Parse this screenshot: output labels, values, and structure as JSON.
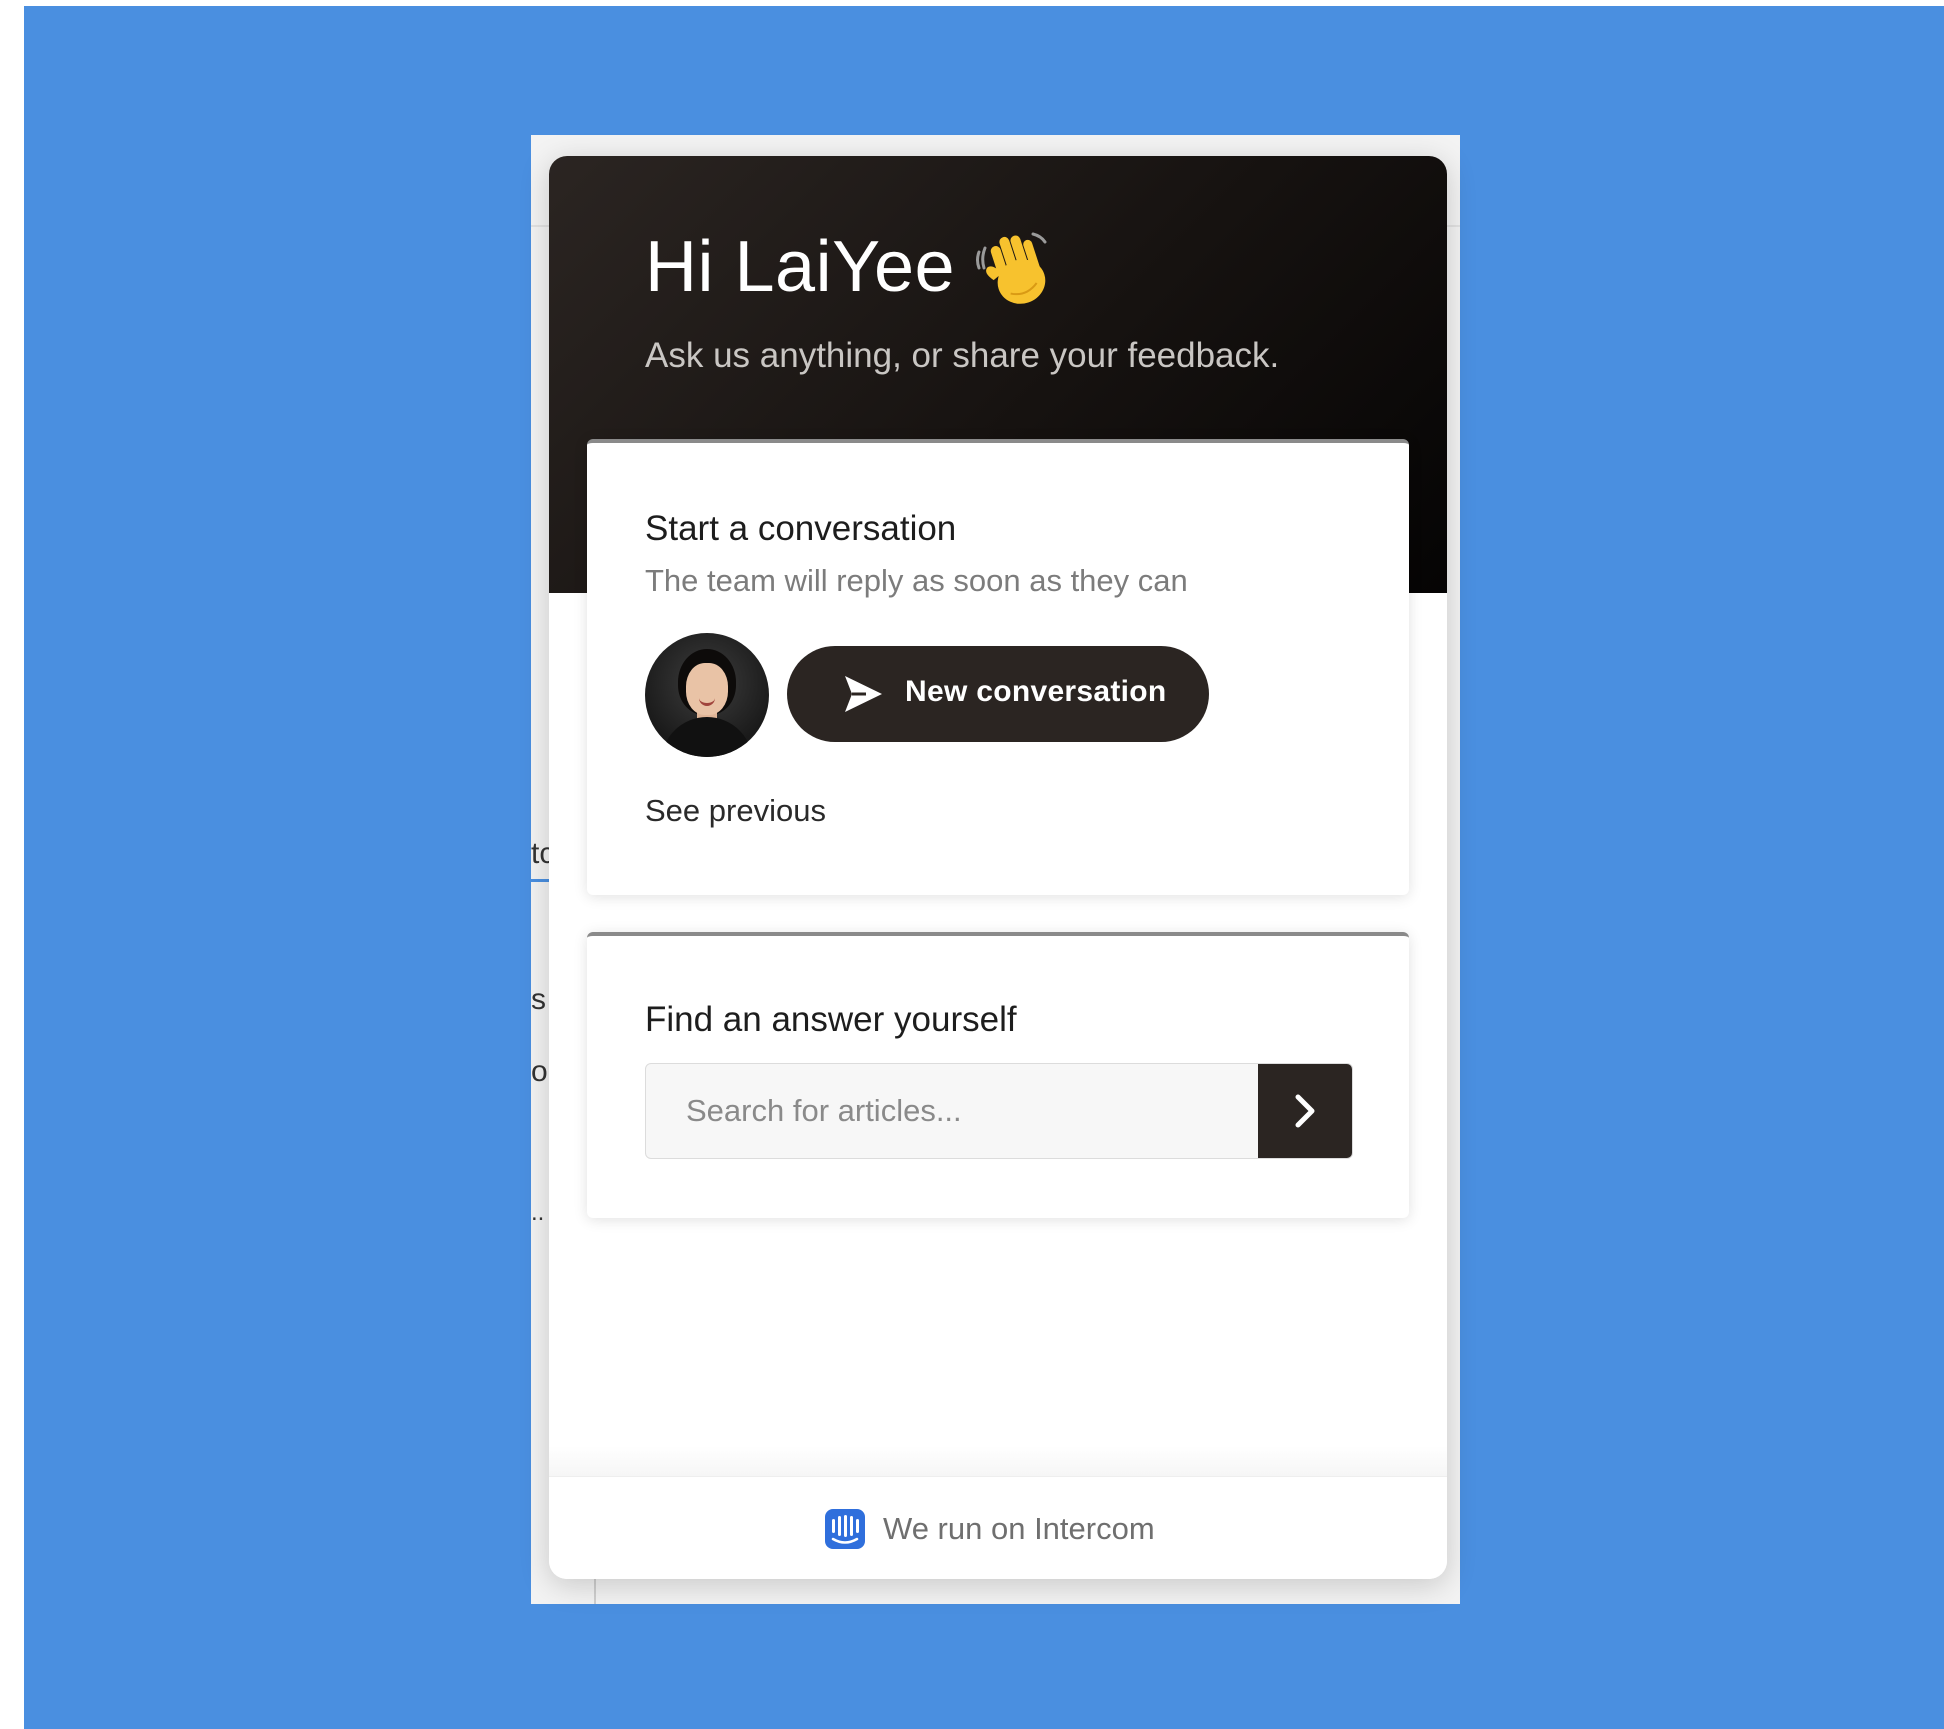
{
  "page_fragment": {
    "text_1": "tc",
    "text_2": "s",
    "text_3": "o",
    "text_4": ".."
  },
  "header": {
    "greeting": "Hi LaiYee",
    "greeting_emoji": "waving-hand-icon",
    "tagline": "Ask us anything, or share your feedback."
  },
  "conversation_card": {
    "title": "Start a conversation",
    "subtitle": "The team will reply as soon as they can",
    "new_button_label": "New conversation",
    "see_previous_label": "See previous"
  },
  "search_card": {
    "title": "Find an answer yourself",
    "placeholder": "Search for articles...",
    "value": ""
  },
  "footer": {
    "label": "We run on Intercom",
    "icon": "intercom-logo-icon"
  },
  "colors": {
    "backdrop": "#4a8fe0",
    "header_dark": "#1a1614",
    "button_dark": "#2b2522",
    "intercom_blue": "#2f6fdc"
  }
}
